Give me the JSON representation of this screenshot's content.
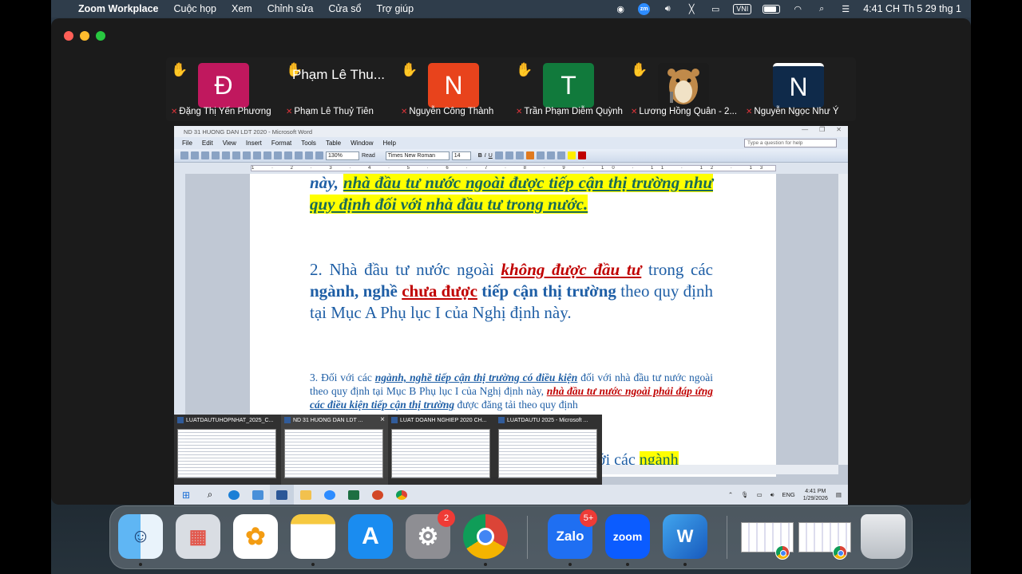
{
  "menubar": {
    "app_name": "Zoom Workplace",
    "menus": [
      "Cuộc họp",
      "Xem",
      "Chỉnh sửa",
      "Cửa sổ",
      "Trợ giúp"
    ],
    "zoom_status": "zm",
    "input_method": "VNI",
    "clock": "4:41 CH Th 5 29 thg 1"
  },
  "participants": [
    {
      "initial": "Đ",
      "name": "Đặng Thị Yến Phương",
      "color": "#c0185e"
    },
    {
      "display": "Phạm Lê Thu...",
      "name": "Phạm Lê Thuỷ Tiên"
    },
    {
      "initial": "N",
      "name": "Nguyễn Công Thành",
      "color": "#e8431c"
    },
    {
      "initial": "T",
      "name": "Trần Phạm Diễm Quỳnh",
      "color": "#117a3c"
    },
    {
      "name": "Lương Hồng Quân - 2..."
    },
    {
      "initial": "N",
      "name": "Nguyễn Ngọc Như Ý",
      "color": "#0f2a4a"
    }
  ],
  "word": {
    "title": "ND 31 HUONG DAN LDT 2020 - Microsoft Word",
    "menus": [
      "File",
      "Edit",
      "View",
      "Insert",
      "Format",
      "Tools",
      "Table",
      "Window",
      "Help"
    ],
    "help_placeholder": "Type a question for help",
    "zoom": "130%",
    "read_label": "Read",
    "font": "Times New Roman",
    "font_size": "14",
    "ruler_text": "1 · 2 · 3 · 4 · 5 · 6 · 7 · 8 · 9 · 10 · 11 · 12 · 13 · 14 · 15 · 16 · 17 · 18 · 20",
    "p1": {
      "a": "này, ",
      "b": "nhà đầu tư nước ngoài được tiếp cận thị trường như quy định đối với nhà đầu tư trong nước."
    },
    "p2": {
      "a": "2. Nhà đầu tư nước ngoài ",
      "b": "không được đầu tư",
      "c": " trong các ",
      "d": "ngành, nghề",
      "e": "chưa được",
      "f": " tiếp cận thị trường",
      "g": " theo quy định tại Mục A Phụ lục I của Nghị định này."
    },
    "p3": {
      "a": "3. Đối với các ",
      "b": "ngành, nghề tiếp cận thị trường có điều kiện",
      "c": " đối với nhà đầu tư nước ngoài theo quy định tại Mục B Phụ lục I của Nghị định này, ",
      "d": "nhà đầu tư nước ngoài",
      "e": " phải đáp ứng",
      "f": " các điều kiện tiếp cận thị trường",
      "g": " được đăng tải theo quy định"
    },
    "fragment_a": "với các ",
    "fragment_b": "ngành"
  },
  "thumbnails": [
    {
      "title": "LUATDAUTUHOPNHAT_2025_C..."
    },
    {
      "title": "ND 31 HUONG DAN LDT ...",
      "close": "×"
    },
    {
      "title": "LUAT DOANH NGHIEP 2020 CH..."
    },
    {
      "title": "LUATDAUTU 2025 - Microsoft ..."
    }
  ],
  "win_taskbar": {
    "lang": "ENG",
    "time": "4:41 PM",
    "date": "1/29/2026"
  },
  "dock": {
    "settings_badge": "2",
    "zalo_label": "Zalo",
    "zalo_badge": "5+",
    "zoom_label": "zoom",
    "word_label": "W"
  }
}
